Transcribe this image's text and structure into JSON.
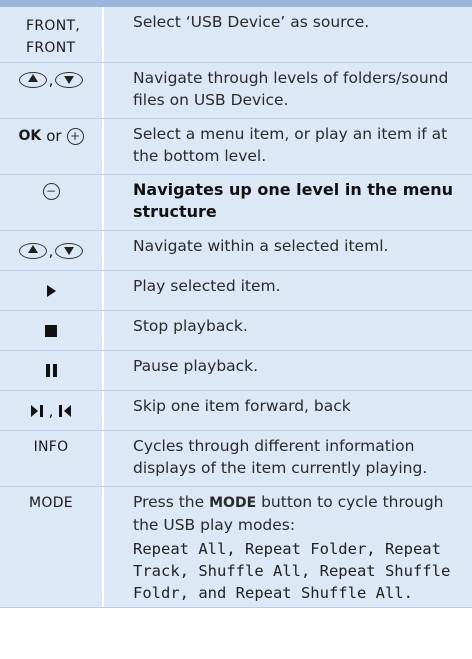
{
  "rows": [
    {
      "key": "FRONT, FRONT",
      "desc": "Select ‘USB Device’ as source."
    },
    {
      "key": "",
      "desc": "Navigate through levels of folders/sound files on USB Device."
    },
    {
      "key_ok": "OK",
      "key_or": "or",
      "desc": "Select a menu item, or play an item if at the bottom level."
    },
    {
      "key": "",
      "desc": "Navigates up one level in the menu structure"
    },
    {
      "key": "",
      "desc": "Navigate within a selected iteml."
    },
    {
      "key": "",
      "desc": "Play selected item."
    },
    {
      "key": "",
      "desc": "Stop playback."
    },
    {
      "key": "",
      "desc": "Pause playback."
    },
    {
      "key": "",
      "desc": "Skip one item forward, back"
    },
    {
      "key": "INFO",
      "desc": "Cycles through different information displays of the item currently playing."
    },
    {
      "key": "MODE",
      "desc_pre": "Press the",
      "desc_key": "MODE",
      "desc_post": "button to cycle through the USB play modes:",
      "modes": "Repeat All, Repeat Folder, Repeat Track, Shuffle All, Repeat Shuffle Foldr, and Repeat Shuffle All."
    }
  ]
}
